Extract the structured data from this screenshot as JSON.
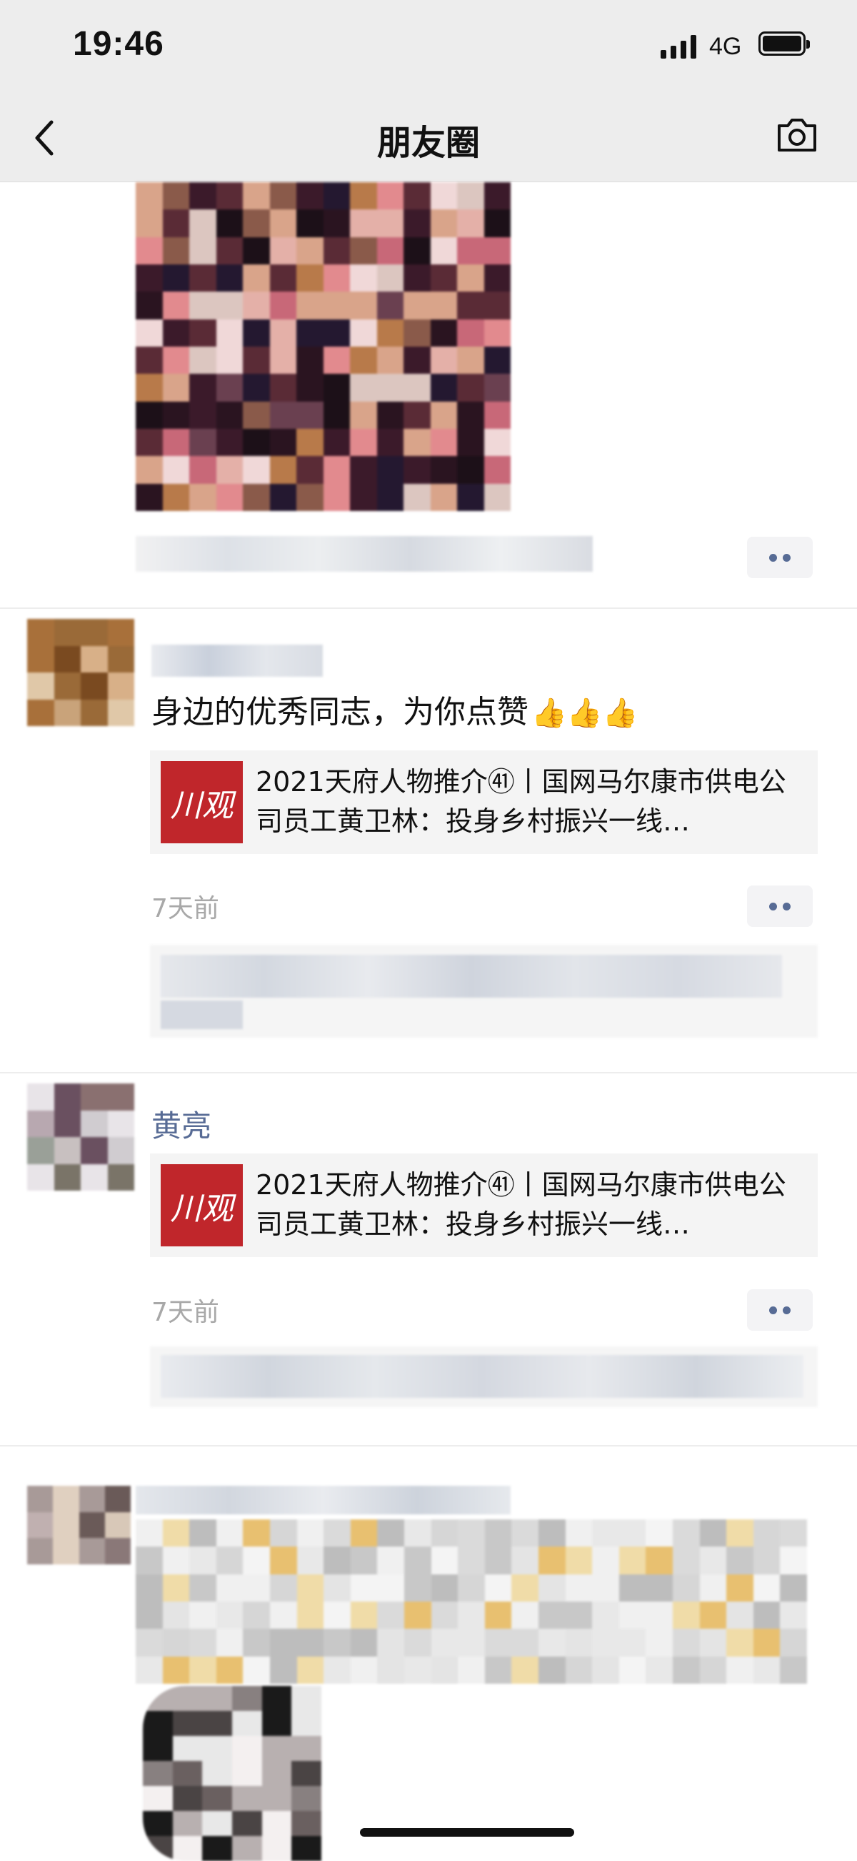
{
  "status": {
    "time": "19:46",
    "network": "4G"
  },
  "nav": {
    "title": "朋友圈"
  },
  "posts": [
    {
      "content": "身边的优秀同志，为你点赞",
      "link": {
        "logo_text": "川观",
        "title": "2021天府人物推介㊶丨国网马尔康市供电公司员工黄卫林：投身乡村振兴一线…"
      },
      "time": "7天前"
    },
    {
      "name": "黄亮",
      "link": {
        "logo_text": "川观",
        "title": "2021天府人物推介㊶丨国网马尔康市供电公司员工黄卫林：投身乡村振兴一线…"
      },
      "time": "7天前"
    }
  ],
  "icons": {
    "back": "back-chevron-icon",
    "camera": "camera-icon",
    "thumbs_up": "thumbs-up-emoji",
    "more": "more-dots-icon"
  },
  "colors": {
    "nav_bg": "#ededed",
    "name_blue": "#576b95",
    "logo_red": "#c0262b",
    "meta_gray": "#a8a8a8"
  }
}
